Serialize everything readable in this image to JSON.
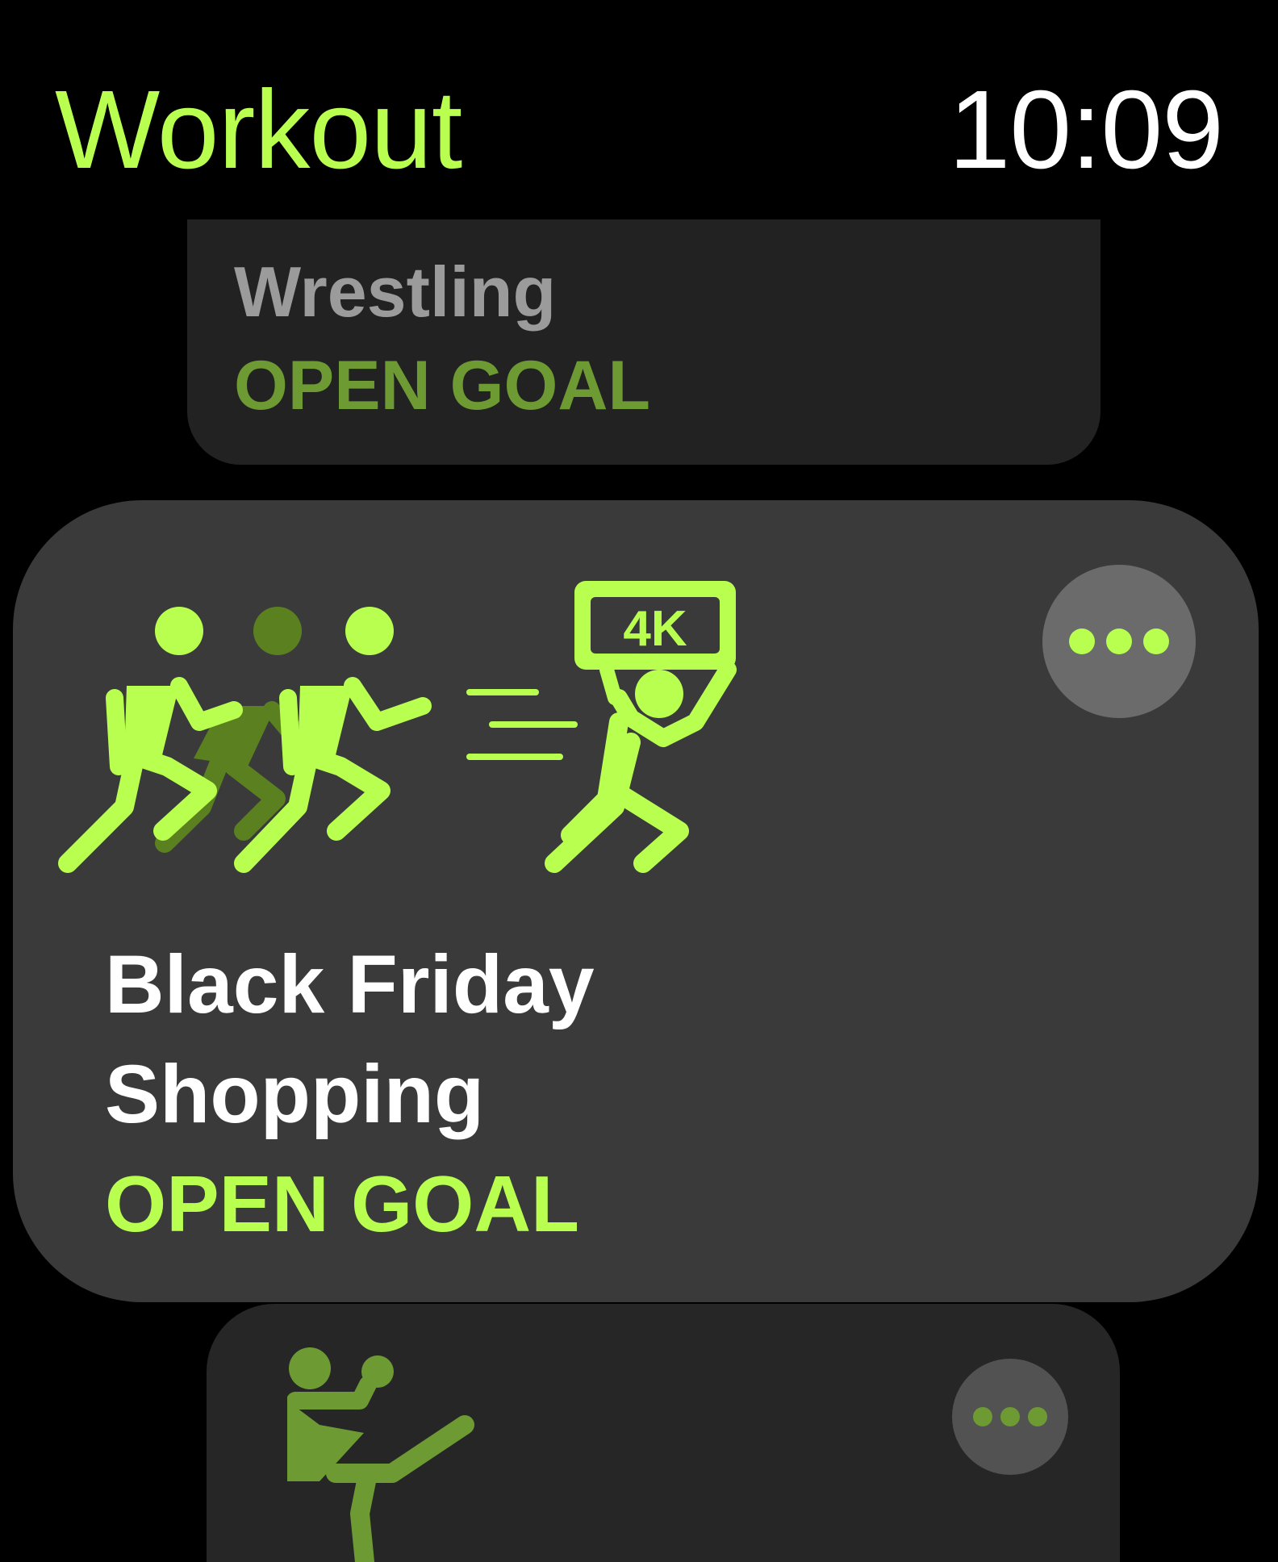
{
  "header": {
    "app_title": "Workout",
    "time": "10:09"
  },
  "cards": [
    {
      "title": "Wrestling",
      "goal": "OPEN GOAL"
    },
    {
      "title": "Black Friday Shopping",
      "goal": "OPEN GOAL",
      "icon": "black-friday-shopping-icon",
      "icon_tv_label": "4K",
      "more_icon": "ellipsis-icon"
    },
    {
      "icon": "kickboxing-icon",
      "more_icon": "ellipsis-icon"
    }
  ],
  "colors": {
    "accent": "#B8FF50",
    "accent_dim": "#6E9A33",
    "accent_shadow": "#5A8020",
    "card_bg": "#3A3A3A",
    "background": "#000000",
    "title_white": "#FFFFFF",
    "title_gray": "#9B9B9B"
  }
}
